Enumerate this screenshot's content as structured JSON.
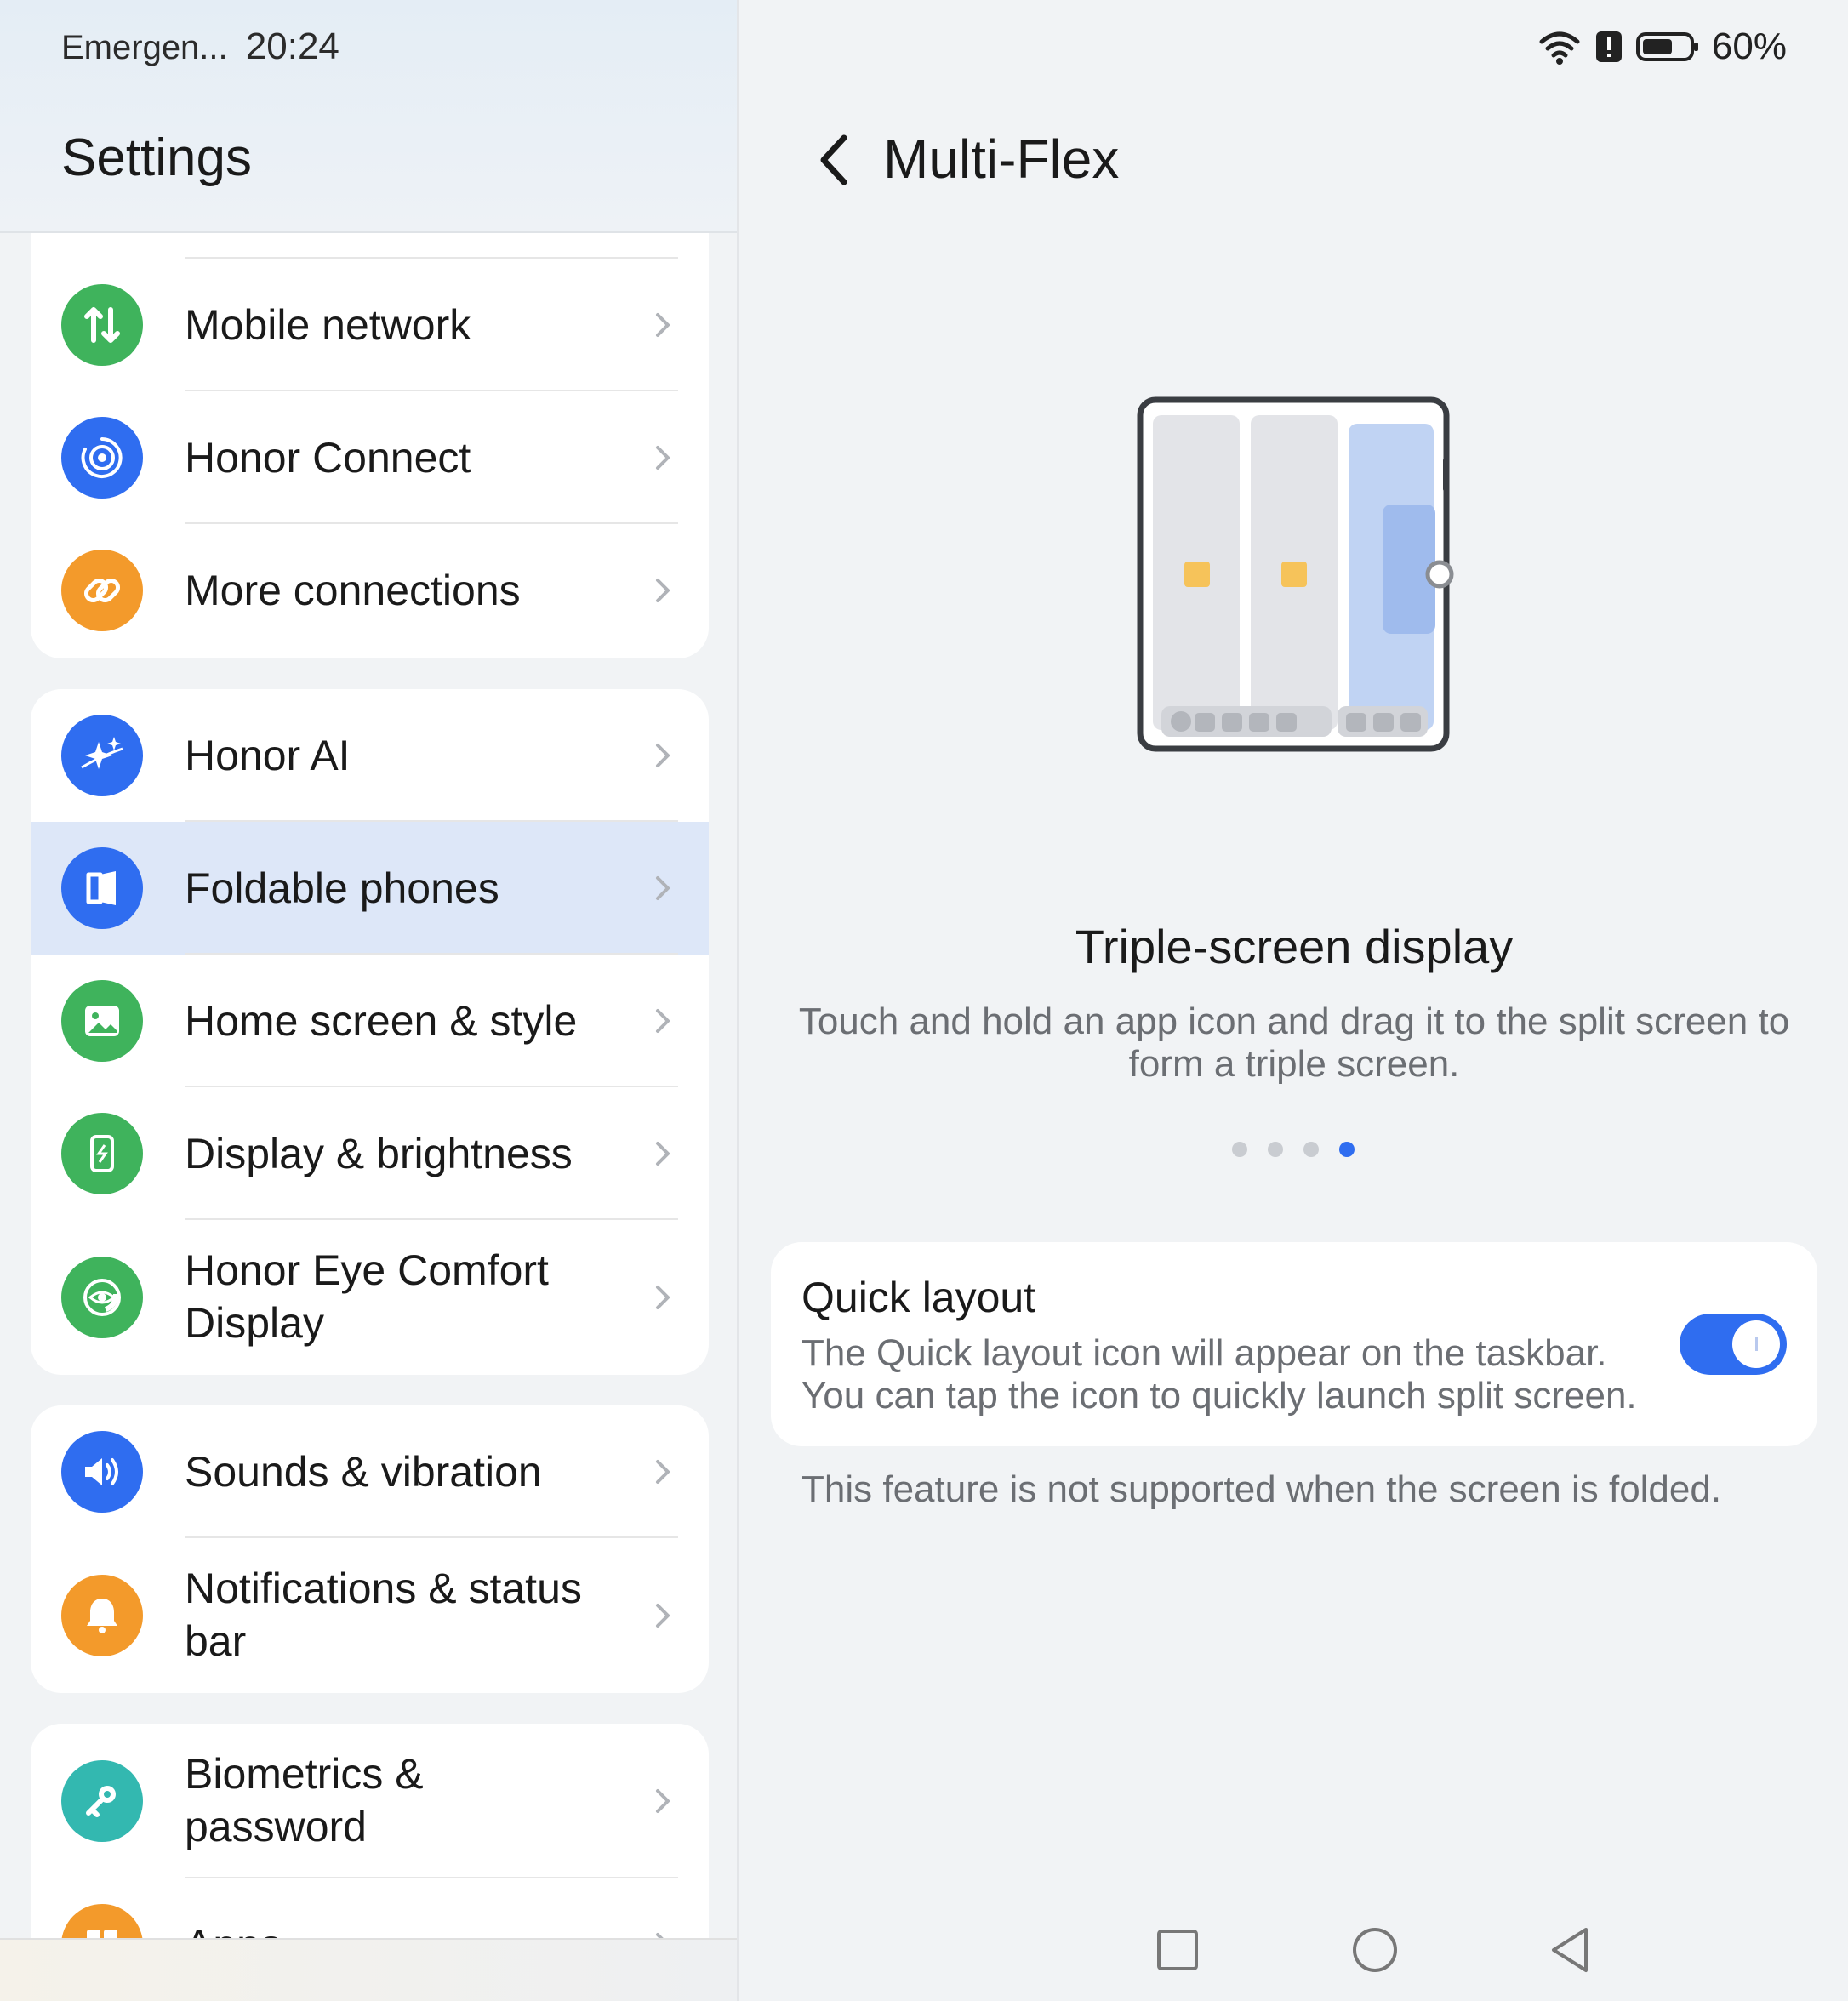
{
  "status_bar": {
    "carrier": "Emergen...",
    "time": "20:24",
    "battery": "60%",
    "icons": [
      "wifi-icon",
      "alert-icon",
      "battery-icon"
    ]
  },
  "settings": {
    "title": "Settings",
    "items": [
      {
        "label": "Mobile network",
        "icon": "mobile-network-icon",
        "color": "#3fb35c"
      },
      {
        "label": "Honor Connect",
        "icon": "honor-connect-icon",
        "color": "#2f6df0"
      },
      {
        "label": "More connections",
        "icon": "link-icon",
        "color": "#f39a2b"
      },
      {
        "label": "Honor AI",
        "icon": "sparkle-icon",
        "color": "#2f6df0"
      },
      {
        "label": "Foldable phones",
        "icon": "foldable-icon",
        "color": "#2f6df0",
        "selected": true
      },
      {
        "label": "Home screen & style",
        "icon": "image-icon",
        "color": "#3fb35c"
      },
      {
        "label": "Display & brightness",
        "icon": "display-icon",
        "color": "#3fb35c"
      },
      {
        "label": "Honor Eye Comfort Display",
        "icon": "eye-comfort-icon",
        "color": "#3fb35c"
      },
      {
        "label": "Sounds & vibration",
        "icon": "speaker-icon",
        "color": "#2f6df0"
      },
      {
        "label": "Notifications & status bar",
        "icon": "bell-icon",
        "color": "#f39a2b"
      },
      {
        "label": "Biometrics & password",
        "icon": "key-icon",
        "color": "#33b8b0"
      },
      {
        "label": "Apps",
        "icon": "apps-icon",
        "color": "#f39a2b"
      }
    ]
  },
  "detail": {
    "title": "Multi-Flex",
    "carousel": {
      "title": "Triple-screen display",
      "description": "Touch and hold an app icon and drag it to the split screen to form a triple screen.",
      "page_count": 4,
      "active_page": 4
    },
    "quick_layout": {
      "title": "Quick layout",
      "description": "The Quick layout icon will appear on the taskbar. You can tap the icon to quickly launch split screen.",
      "enabled": true
    },
    "footnote": "This feature is not supported when the screen is folded."
  },
  "nav_bar": {
    "icons": [
      "recents-icon",
      "home-icon",
      "back-nav-icon"
    ]
  },
  "colors": {
    "accent": "#2f6df0",
    "selected_row": "#dde7f8",
    "background": "#f1f3f5"
  }
}
